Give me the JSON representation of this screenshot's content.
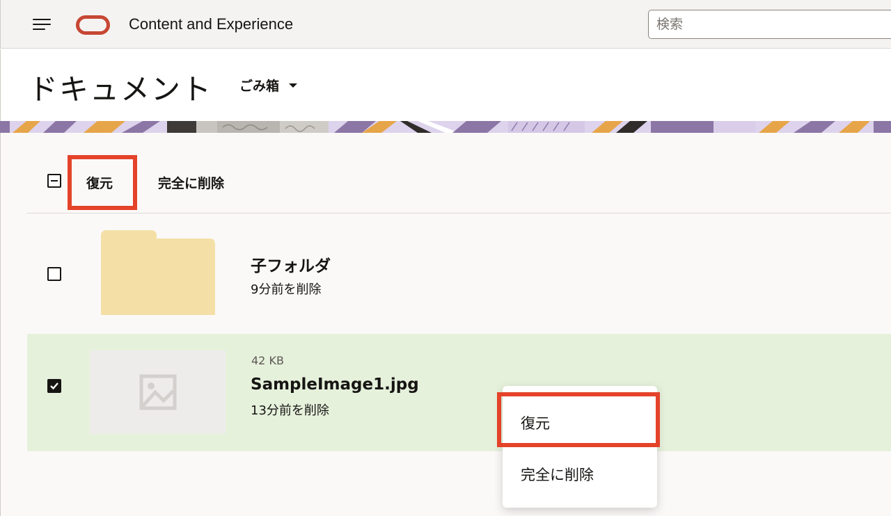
{
  "header": {
    "app_title": "Content and Experience",
    "search_placeholder": "検索",
    "menu_icon": "hamburger-icon",
    "logo": "oracle-logo",
    "logo_color": "#c74634"
  },
  "page": {
    "title": "ドキュメント",
    "view_selector": "ごみ箱"
  },
  "toolbar": {
    "restore_label": "復元",
    "delete_permanently_label": "完全に削除",
    "select_all_state": "indeterminate"
  },
  "items": [
    {
      "name": "子フォルダ",
      "deleted_info": "9分前を削除",
      "type": "folder",
      "checked": false
    },
    {
      "size": "42 KB",
      "name": "SampleImage1.jpg",
      "deleted_info": "13分前を削除",
      "type": "image",
      "checked": true
    }
  ],
  "context_menu": {
    "items": [
      "復元",
      "完全に削除"
    ]
  },
  "colors": {
    "highlight": "#e4432a",
    "selected_row": "#e6f1dc",
    "folder": "#f4e0a6"
  }
}
